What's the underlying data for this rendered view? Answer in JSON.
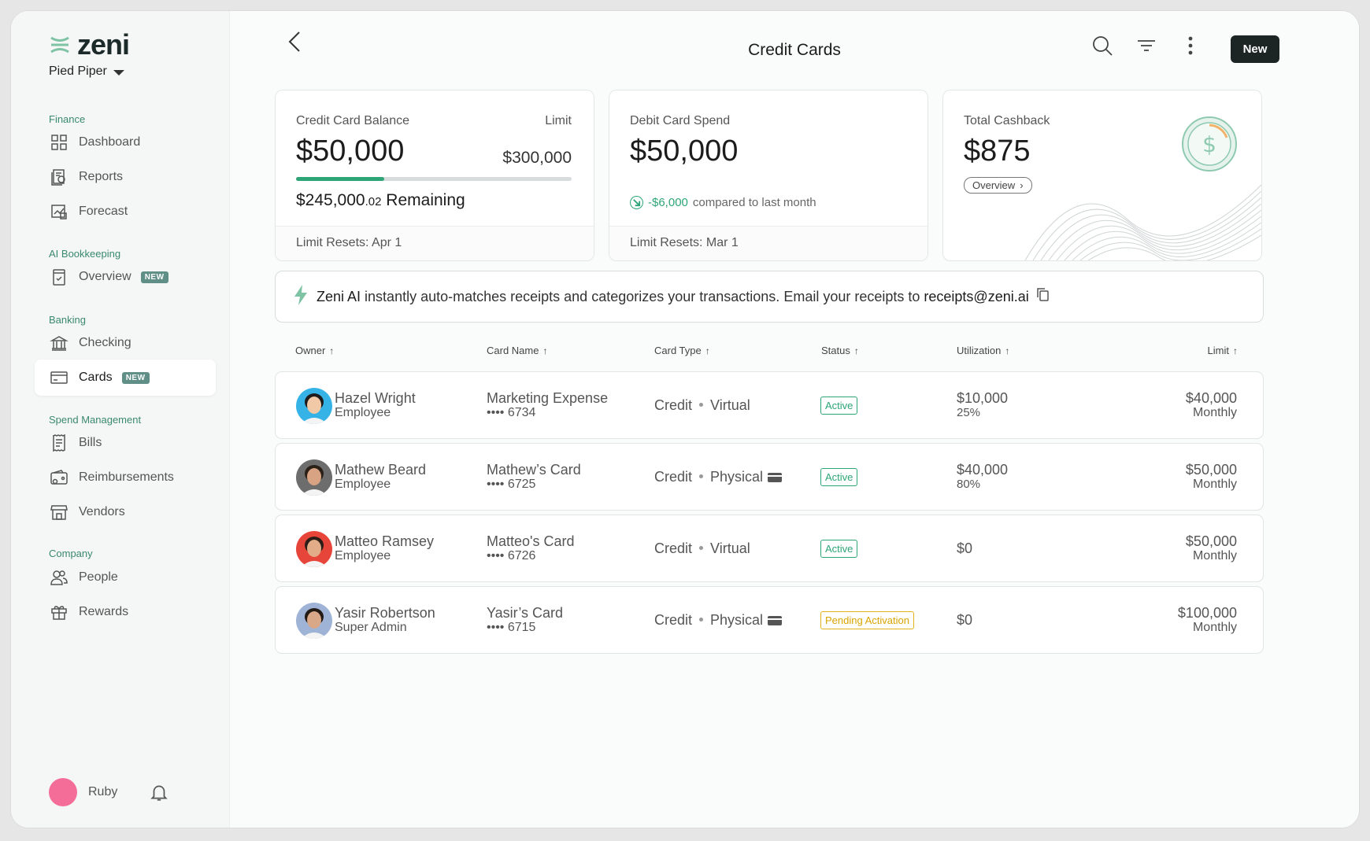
{
  "brand": {
    "logo_text": "zeni",
    "org": "Pied Piper"
  },
  "sidebar": {
    "sections": [
      {
        "label": "Finance",
        "items": [
          {
            "label": "Dashboard",
            "icon": "dashboard-icon"
          },
          {
            "label": "Reports",
            "icon": "reports-icon"
          },
          {
            "label": "Forecast",
            "icon": "forecast-icon"
          }
        ]
      },
      {
        "label": "AI Bookkeeping",
        "items": [
          {
            "label": "Overview",
            "icon": "checklist-icon",
            "badge": "NEW"
          }
        ]
      },
      {
        "label": "Banking",
        "items": [
          {
            "label": "Checking",
            "icon": "bank-icon"
          },
          {
            "label": "Cards",
            "icon": "card-icon",
            "badge": "NEW",
            "active": true
          }
        ]
      },
      {
        "label": "Spend Management",
        "items": [
          {
            "label": "Bills",
            "icon": "bill-icon"
          },
          {
            "label": "Reimbursements",
            "icon": "wallet-icon"
          },
          {
            "label": "Vendors",
            "icon": "store-icon"
          }
        ]
      },
      {
        "label": "Company",
        "items": [
          {
            "label": "People",
            "icon": "people-icon"
          },
          {
            "label": "Rewards",
            "icon": "gift-icon"
          }
        ]
      }
    ],
    "user": {
      "name": "Ruby",
      "avatar_color": "#f46d99"
    }
  },
  "header": {
    "title": "Credit Cards",
    "new_button": "New"
  },
  "summary": {
    "credit": {
      "label": "Credit Card Balance",
      "value": "$50,000",
      "limit_label": "Limit",
      "limit_value": "$300,000",
      "progress": 0.32,
      "remaining_main": "$245,000",
      "remaining_cents": ".02",
      "remaining_label": "Remaining",
      "footer": "Limit Resets: Apr 1"
    },
    "debit": {
      "label": "Debit Card Spend",
      "value": "$50,000",
      "change": "-$6,000",
      "change_text": "compared to last month",
      "footer": "Limit Resets: Mar 1"
    },
    "cashback": {
      "label": "Total Cashback",
      "value": "$875",
      "button": "Overview"
    }
  },
  "banner": {
    "brand": "Zeni AI",
    "text": "instantly auto-matches receipts and categorizes your transactions. Email your receipts to",
    "email": "receipts@zeni.ai"
  },
  "table": {
    "columns": [
      "Owner",
      "Card Name",
      "Card Type",
      "Status",
      "Utilization",
      "Limit"
    ],
    "rows": [
      {
        "name": "Hazel Wright",
        "role": "Employee",
        "card": "Marketing Expense",
        "last4": "•••• 6734",
        "kind": "Credit",
        "form": "Virtual",
        "physical": false,
        "status": "Active",
        "util": "$10,000",
        "util_pct": "25%",
        "limit": "$40,000",
        "period": "Monthly",
        "avatar_bg": "#36b3e6",
        "skin": "#f2c9a6",
        "hair": "#1c1c1c"
      },
      {
        "name": "Mathew Beard",
        "role": "Employee",
        "card": "Mathew’s Card",
        "last4": "•••• 6725",
        "kind": "Credit",
        "form": "Physical",
        "physical": true,
        "status": "Active",
        "util": "$40,000",
        "util_pct": "80%",
        "limit": "$50,000",
        "period": "Monthly",
        "avatar_bg": "#6d6d6d",
        "skin": "#d8a383",
        "hair": "#2a2018"
      },
      {
        "name": "Matteo Ramsey",
        "role": "Employee",
        "card": "Matteo's Card",
        "last4": "•••• 6726",
        "kind": "Credit",
        "form": "Virtual",
        "physical": false,
        "status": "Active",
        "util": "$0",
        "util_pct": "",
        "limit": "$50,000",
        "period": "Monthly",
        "avatar_bg": "#e8453a",
        "skin": "#e2ac88",
        "hair": "#2c1e16"
      },
      {
        "name": "Yasir Robertson",
        "role": "Super Admin",
        "card": "Yasir’s Card",
        "last4": "•••• 6715",
        "kind": "Credit",
        "form": "Physical",
        "physical": true,
        "status": "Pending Activation",
        "util": "$0",
        "util_pct": "",
        "limit": "$100,000",
        "period": "Monthly",
        "avatar_bg": "#9fb3d6",
        "skin": "#d9a888",
        "hair": "#231a14"
      }
    ]
  }
}
